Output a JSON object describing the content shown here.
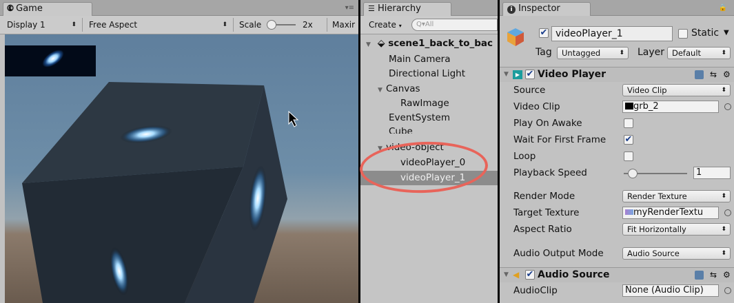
{
  "game": {
    "tab_title": "Game",
    "display": "Display 1",
    "aspect": "Free Aspect",
    "scale_label": "Scale",
    "scale_value": "2x",
    "maximize": "Maxir"
  },
  "hierarchy": {
    "tab_title": "Hierarchy",
    "create_label": "Create",
    "search_placeholder": "Q▾All",
    "items": [
      {
        "label": "scene1_back_to_bac"
      },
      {
        "label": "Main Camera"
      },
      {
        "label": "Directional Light"
      },
      {
        "label": "Canvas"
      },
      {
        "label": "RawImage"
      },
      {
        "label": "EventSystem"
      },
      {
        "label": "Cube"
      },
      {
        "label": "video-object"
      },
      {
        "label": "videoPlayer_0"
      },
      {
        "label": "videoPlayer_1"
      }
    ]
  },
  "inspector": {
    "tab_title": "Inspector",
    "object_name": "videoPlayer_1",
    "static_label": "Static",
    "tag_label": "Tag",
    "tag_value": "Untagged",
    "layer_label": "Layer",
    "layer_value": "Default",
    "video_player": {
      "title": "Video Player",
      "source_label": "Source",
      "source_value": "Video Clip",
      "clip_label": "Video Clip",
      "clip_value": "grb_2",
      "play_on_awake_label": "Play On Awake",
      "play_on_awake": false,
      "wait_label": "Wait For First Frame",
      "wait": true,
      "loop_label": "Loop",
      "loop": false,
      "speed_label": "Playback Speed",
      "speed_value": "1",
      "render_mode_label": "Render Mode",
      "render_mode_value": "Render Texture",
      "target_label": "Target Texture",
      "target_value": "myRenderTextu",
      "aspect_label": "Aspect Ratio",
      "aspect_value": "Fit Horizontally",
      "audio_mode_label": "Audio Output Mode",
      "audio_mode_value": "Audio Source"
    },
    "audio_source": {
      "title": "Audio Source",
      "clip_label": "AudioClip",
      "clip_value": "None (Audio Clip)"
    }
  },
  "colors": {
    "highlight_ring": "#e8645a",
    "selected_row": "#8c8c8c"
  }
}
